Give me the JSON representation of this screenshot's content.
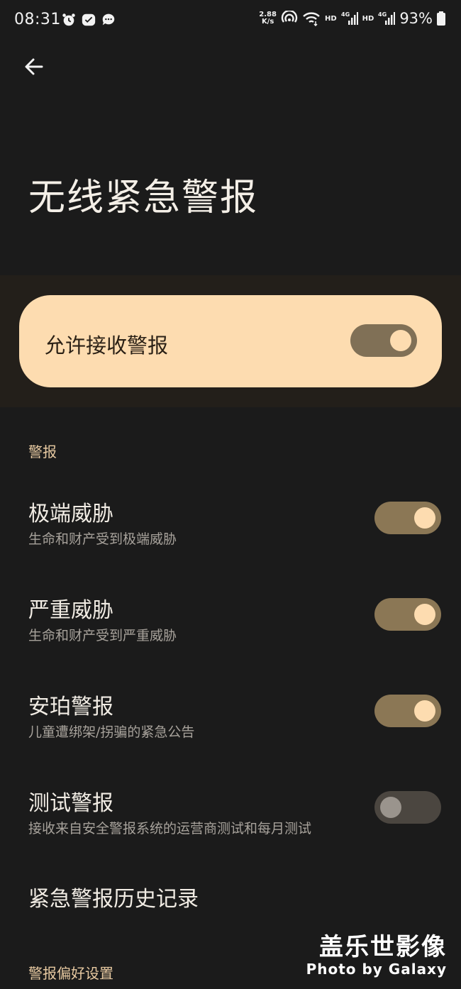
{
  "status_bar": {
    "time": "08:31",
    "net_speed_value": "2.88",
    "net_speed_unit": "K/s",
    "hd_1": "HD",
    "hd_2": "HD",
    "battery": "93%",
    "icons": [
      "alarm-icon",
      "app-check-icon",
      "chat-icon",
      "hotspot-icon",
      "wifi-icon",
      "signal-4g-icon",
      "signal-4g-icon",
      "battery-icon"
    ]
  },
  "header": {
    "title": "无线紧急警报"
  },
  "master": {
    "label": "允许接收警报",
    "enabled": true
  },
  "sections": {
    "alerts_header": "警报",
    "preferences_header": "警报偏好设置"
  },
  "alerts": [
    {
      "title": "极端威胁",
      "subtitle": "生命和财产受到极端威胁",
      "enabled": true
    },
    {
      "title": "严重威胁",
      "subtitle": "生命和财产受到严重威胁",
      "enabled": true
    },
    {
      "title": "安珀警报",
      "subtitle": "儿童遭绑架/拐骗的紧急公告",
      "enabled": true
    },
    {
      "title": "测试警报",
      "subtitle": "接收来自安全警报系统的运营商测试和每月测试",
      "enabled": false
    }
  ],
  "history": {
    "label": "紧急警报历史记录"
  },
  "watermark": {
    "cn": "盖乐世影像",
    "en": "Photo by Galaxy"
  },
  "colors": {
    "background": "#1b1b1b",
    "accent": "#fddcb0",
    "switch_on": "#8b7755",
    "switch_off": "#4b4640"
  }
}
